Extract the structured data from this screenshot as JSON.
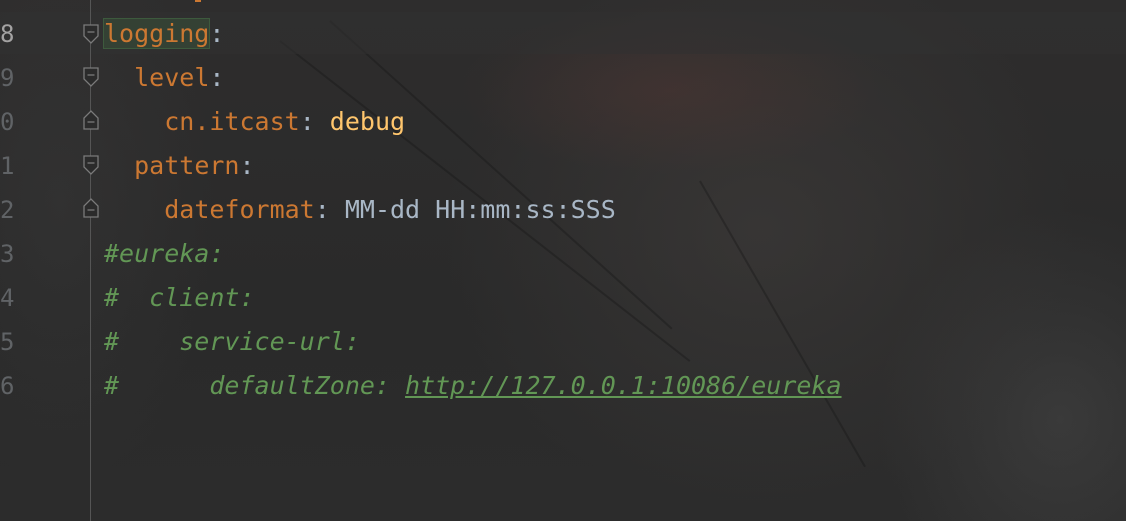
{
  "editor": {
    "line_numbers": [
      "8",
      "9",
      "0",
      "1",
      "2",
      "3",
      "4",
      "5",
      "6"
    ],
    "lines": [
      {
        "indent": "",
        "key": "logging",
        "colon": ":",
        "value": ""
      },
      {
        "indent": "  ",
        "key": "level",
        "colon": ":",
        "value": ""
      },
      {
        "indent": "    ",
        "key": "cn.itcast",
        "colon": ": ",
        "value": "debug"
      },
      {
        "indent": "  ",
        "key": "pattern",
        "colon": ":",
        "value": ""
      },
      {
        "indent": "    ",
        "key": "dateformat",
        "colon": ": ",
        "value": "MM-dd HH:mm:ss:SSS"
      },
      {
        "comment": "#eureka:"
      },
      {
        "comment": "#  client:"
      },
      {
        "comment": "#    service-url:"
      },
      {
        "comment": "#      defaultZone: ",
        "link": "http://127.0.0.1:10086/eureka"
      }
    ]
  },
  "colors": {
    "background": "#2b2b2b",
    "yaml_key": "#cc7832",
    "yaml_value": "#ffc66d",
    "plain_text": "#a9b7c6",
    "comment": "#629755",
    "line_number": "#606366"
  },
  "icons": {
    "fold_open": "fold-open-icon",
    "fold_close": "fold-close-icon"
  }
}
